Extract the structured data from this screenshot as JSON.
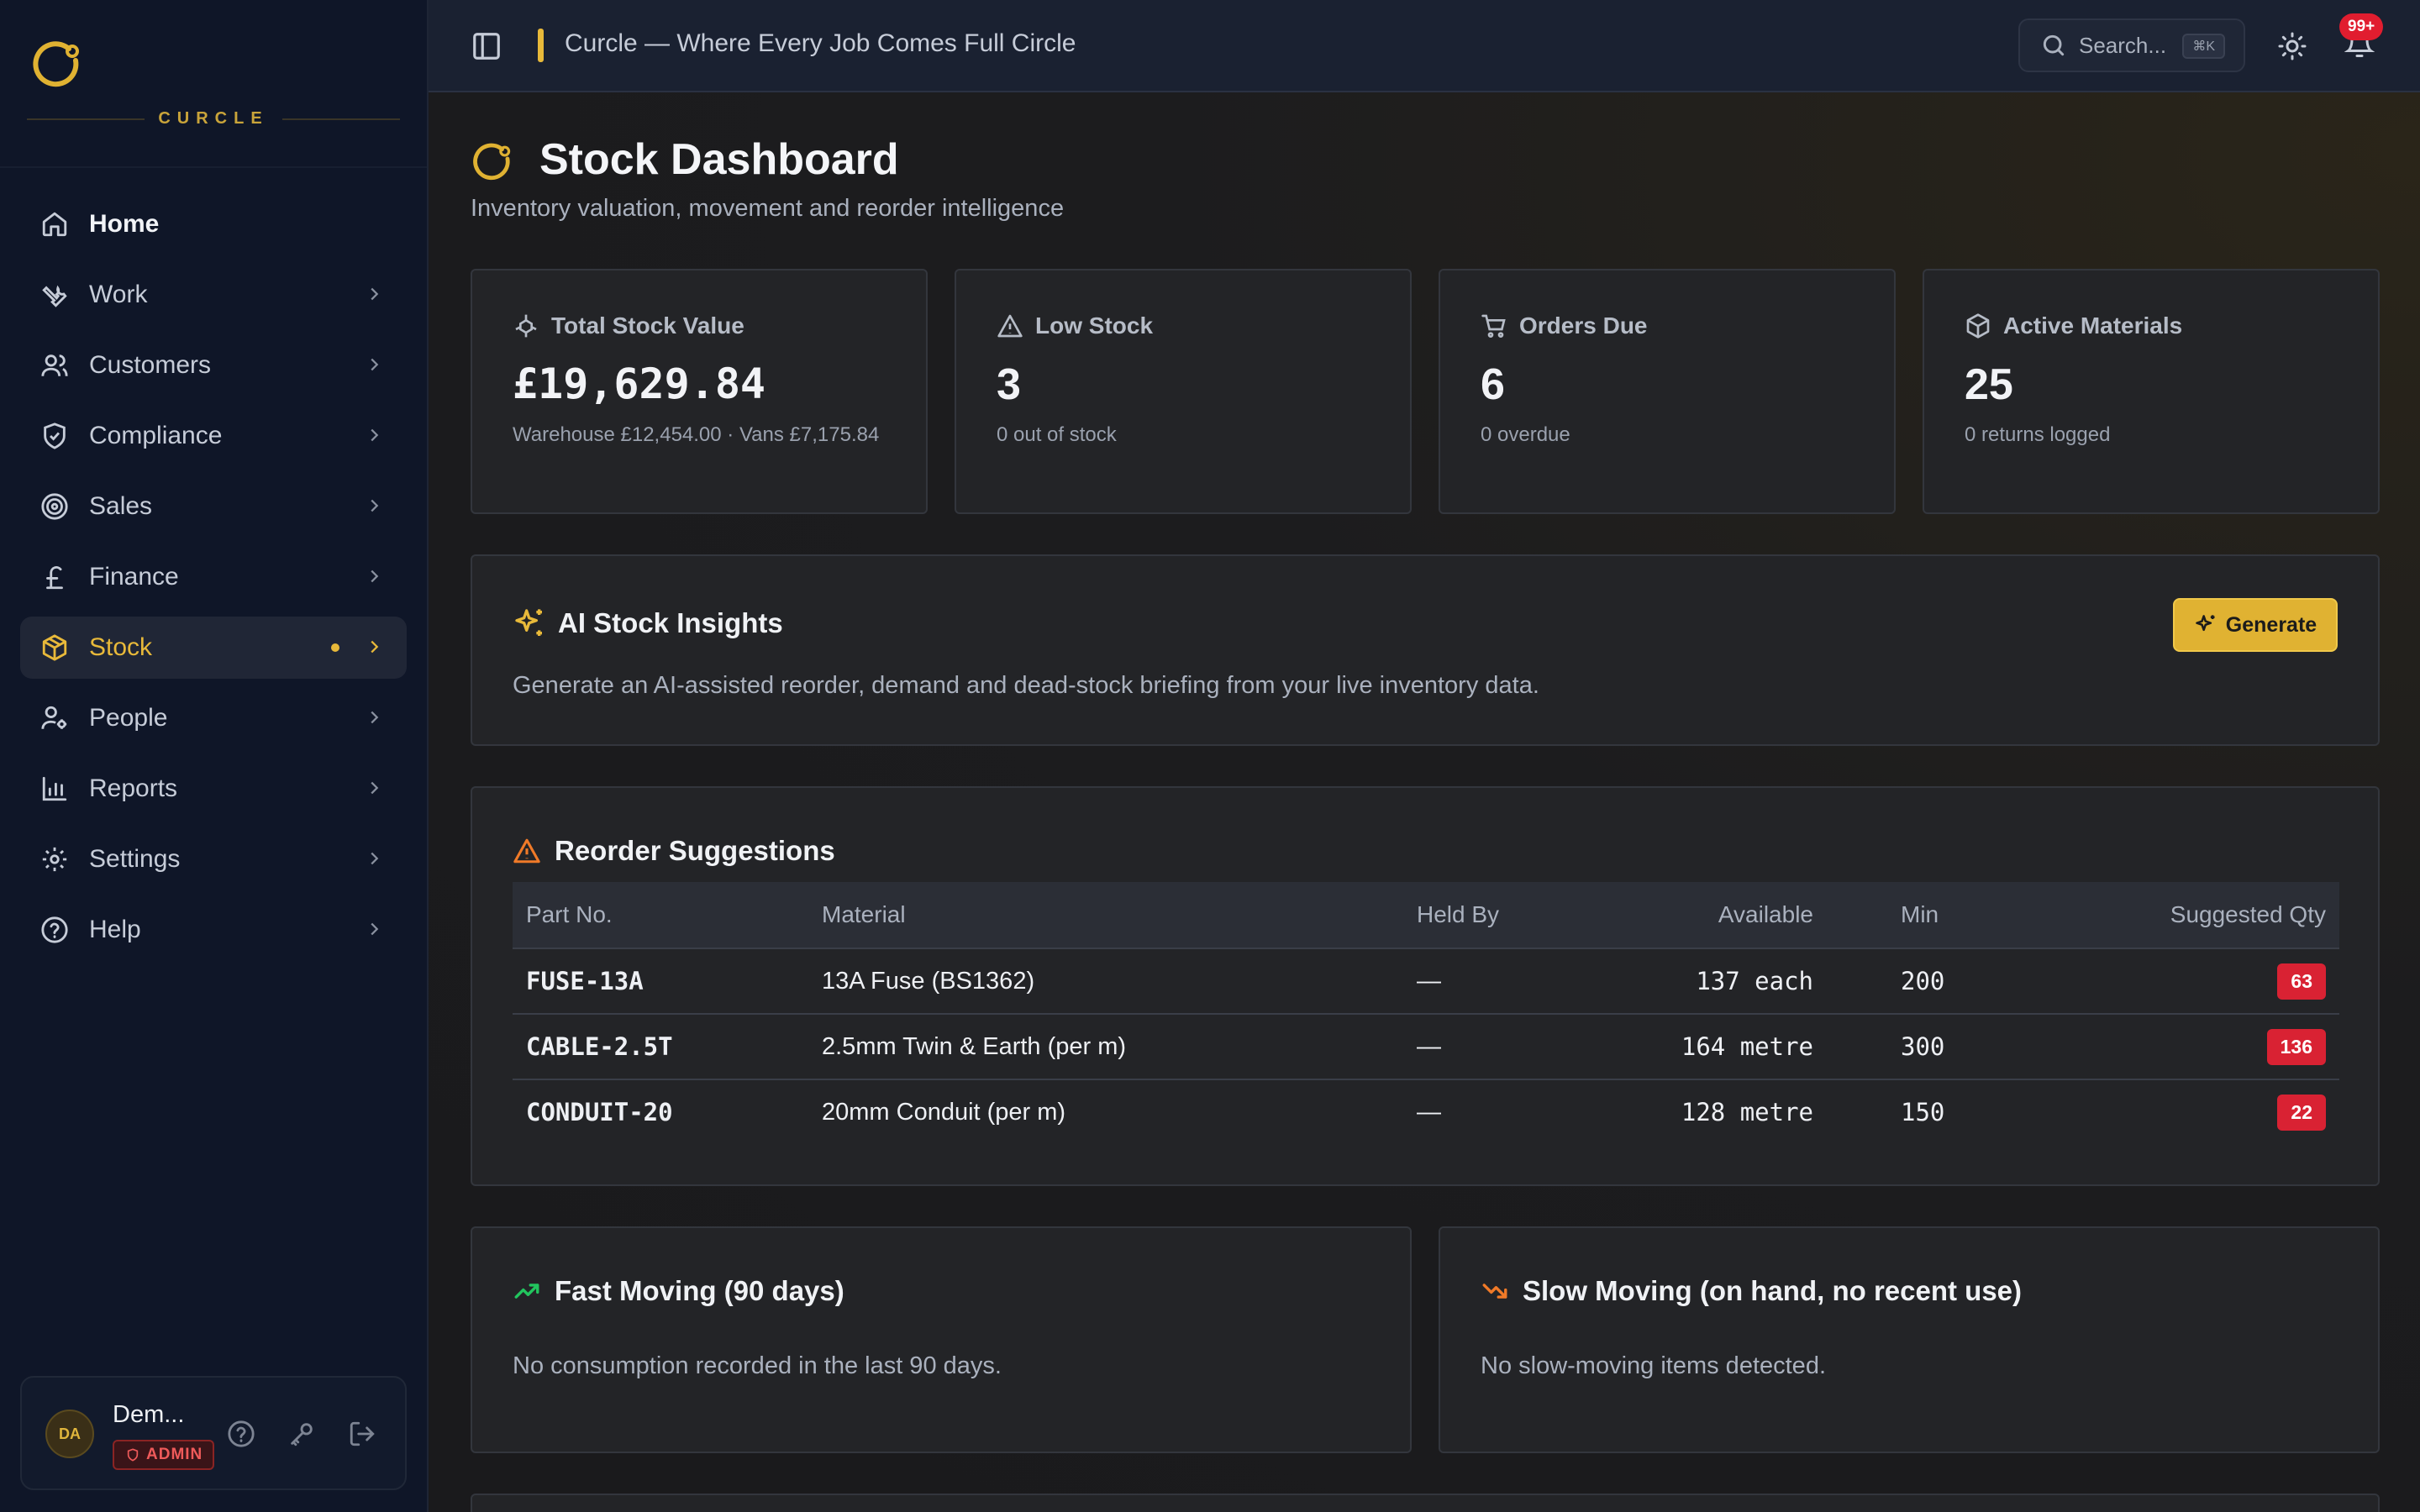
{
  "brand": {
    "wordmark": "CURCLE"
  },
  "sidebar": {
    "items": [
      {
        "label": "Home"
      },
      {
        "label": "Work"
      },
      {
        "label": "Customers"
      },
      {
        "label": "Compliance"
      },
      {
        "label": "Sales"
      },
      {
        "label": "Finance"
      },
      {
        "label": "Stock"
      },
      {
        "label": "People"
      },
      {
        "label": "Reports"
      },
      {
        "label": "Settings"
      },
      {
        "label": "Help"
      }
    ],
    "active_item": "Stock"
  },
  "user": {
    "initials": "DA",
    "name": "Dem...",
    "role": "ADMIN"
  },
  "topbar": {
    "app_title": "Curcle — Where Every Job Comes Full Circle",
    "search_placeholder": "Search...",
    "search_shortcut": "⌘K",
    "notification_count": "99+"
  },
  "page": {
    "title": "Stock Dashboard",
    "subtitle": "Inventory valuation, movement and reorder intelligence"
  },
  "stats": [
    {
      "label": "Total Stock Value",
      "value": "£19,629.84",
      "sub": "Warehouse £12,454.00 · Vans £7,175.84"
    },
    {
      "label": "Low Stock",
      "value": "3",
      "sub": "0 out of stock"
    },
    {
      "label": "Orders Due",
      "value": "6",
      "sub": "0 overdue"
    },
    {
      "label": "Active Materials",
      "value": "25",
      "sub": "0 returns logged"
    }
  ],
  "insights": {
    "title": "AI Stock Insights",
    "description": "Generate an AI-assisted reorder, demand and dead-stock briefing from your live inventory data.",
    "button": "Generate"
  },
  "reorder": {
    "title": "Reorder Suggestions",
    "columns": [
      "Part No.",
      "Material",
      "Held By",
      "Available",
      "Min",
      "Suggested Qty"
    ],
    "rows": [
      {
        "part": "FUSE-13A",
        "material": "13A Fuse (BS1362)",
        "held_by": "—",
        "available": "137 each",
        "min": "200",
        "qty": "63"
      },
      {
        "part": "CABLE-2.5T",
        "material": "2.5mm Twin & Earth (per m)",
        "held_by": "—",
        "available": "164 metre",
        "min": "300",
        "qty": "136"
      },
      {
        "part": "CONDUIT-20",
        "material": "20mm Conduit (per m)",
        "held_by": "—",
        "available": "128 metre",
        "min": "150",
        "qty": "22"
      }
    ]
  },
  "fast_moving": {
    "title": "Fast Moving (90 days)",
    "empty": "No consumption recorded in the last 90 days."
  },
  "slow_moving": {
    "title": "Slow Moving (on hand, no recent use)",
    "empty": "No slow-moving items detected."
  },
  "colors": {
    "accent": "#e8b93a",
    "danger": "#d92233",
    "sidebar_bg": "#0f1628"
  }
}
